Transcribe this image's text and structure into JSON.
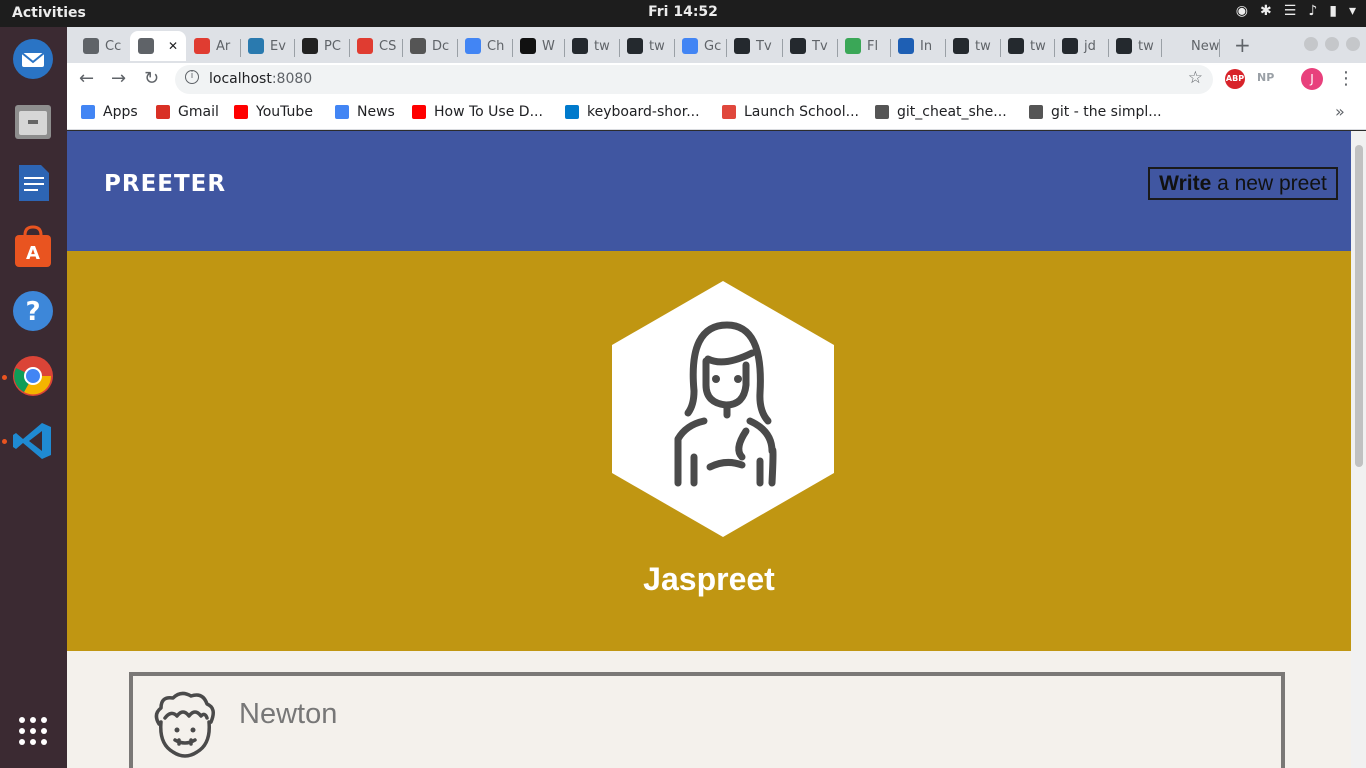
{
  "system": {
    "activities": "Activities",
    "clock": "Fri 14:52"
  },
  "tabs": [
    {
      "label": "Cc",
      "color": "#5f6368"
    },
    {
      "label": "",
      "color": "#5f6368",
      "active": true
    },
    {
      "label": "Ar",
      "color": "#e03c31"
    },
    {
      "label": "Ev",
      "color": "#2a7aaf"
    },
    {
      "label": "PC",
      "color": "#222222"
    },
    {
      "label": "CS",
      "color": "#e03c31"
    },
    {
      "label": "Dc",
      "color": "#555555"
    },
    {
      "label": "Ch",
      "color": "#4285f4"
    },
    {
      "label": "W",
      "color": "#111111"
    },
    {
      "label": "tw",
      "color": "#24292e"
    },
    {
      "label": "tw",
      "color": "#24292e"
    },
    {
      "label": "Gc",
      "color": "#4285f4"
    },
    {
      "label": "Tv",
      "color": "#24292e"
    },
    {
      "label": "Tv",
      "color": "#24292e"
    },
    {
      "label": "Fl",
      "color": "#3aa757"
    },
    {
      "label": "In",
      "color": "#1e5fb4"
    },
    {
      "label": "tw",
      "color": "#24292e"
    },
    {
      "label": "tw",
      "color": "#24292e"
    },
    {
      "label": "jd",
      "color": "#24292e"
    },
    {
      "label": "tw",
      "color": "#24292e"
    },
    {
      "label": "New",
      "color": "#dee1e6"
    }
  ],
  "toolbar": {
    "url_host": "localhost",
    "url_port": ":8080",
    "abp": "ABP",
    "np": "NP",
    "avatar_letter": "J"
  },
  "bookmarks": [
    {
      "label": "Apps",
      "color": "#4285f4"
    },
    {
      "label": "Gmail",
      "color": "#d93025"
    },
    {
      "label": "YouTube",
      "color": "#ff0000"
    },
    {
      "label": "News",
      "color": "#4285f4"
    },
    {
      "label": "How To Use D...",
      "color": "#ff0000"
    },
    {
      "label": "keyboard-shor...",
      "color": "#007acc"
    },
    {
      "label": "Launch School...",
      "color": "#e0473c"
    },
    {
      "label": "git_cheat_she...",
      "color": "#555555"
    },
    {
      "label": "git - the simpl...",
      "color": "#555555"
    }
  ],
  "page": {
    "logo": "PREETER",
    "write_bold": "Write",
    "write_rest": " a new preet",
    "profile_name": "Jaspreet",
    "tweet_author": "Newton",
    "colors": {
      "header": "#4056a1",
      "profile": "#c09612",
      "background": "#f4f1ec"
    }
  }
}
